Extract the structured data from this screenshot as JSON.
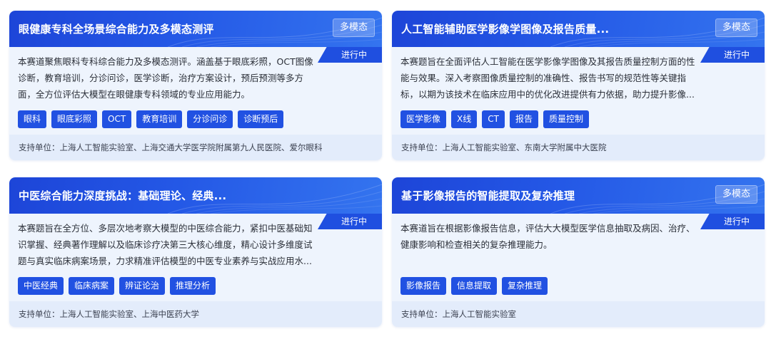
{
  "cards": [
    {
      "title": "眼健康专科全场景综合能力及多模态测评",
      "modality": "多模态",
      "status": "进行中",
      "desc": [
        "本赛道聚焦眼科专科综合能力及多模态测评。涵盖基于眼底彩照，OCT图像",
        "诊断，教育培训，分诊问诊，医学诊断，治疗方案设计，预后预测等多方",
        "面，全方位评估大模型在眼健康专科领域的专业应用能力。"
      ],
      "tags": [
        "眼科",
        "眼底彩照",
        "OCT",
        "教育培训",
        "分诊问诊",
        "诊断预后"
      ],
      "support": "支持单位：上海人工智能实验室、上海交通大学医学院附属第九人民医院、爱尔眼科"
    },
    {
      "title": "人工智能辅助医学影像学图像及报告质量...",
      "modality": "多模态",
      "status": "进行中",
      "desc": [
        "本赛题旨在全面评估人工智能在医学影像学图像及其报告质量控制方面的性",
        "能与效果。深入考察图像质量控制的准确性、报告书写的规范性等关键指",
        "标，以期为该技术在临床应用中的优化改进提供有力依据，助力提升影像..."
      ],
      "tags": [
        "医学影像",
        "X线",
        "CT",
        "报告",
        "质量控制"
      ],
      "support": "支持单位：上海人工智能实验室、东南大学附属中大医院"
    },
    {
      "title": "中医综合能力深度挑战：基础理论、经典...",
      "status": "进行中",
      "desc": [
        "本赛题旨在全方位、多层次地考察大模型的中医综合能力，紧扣中医基础知",
        "识掌握、经典著作理解以及临床诊疗决第三大核心维度，精心设计多维度试",
        "题与真实临床病案场景，力求精准评估模型的中医专业素养与实战应用水..."
      ],
      "tags": [
        "中医经典",
        "临床病案",
        "辨证论治",
        "推理分析"
      ],
      "support": "支持单位：上海人工智能实验室、上海中医药大学"
    },
    {
      "title": "基于影像报告的智能提取及复杂推理",
      "modality": "多模态",
      "status": "进行中",
      "desc": [
        "本赛道旨在根据影像报告信息，评估大大模型医学信息抽取及病因、治疗、",
        "健康影响和检查相关的复杂推理能力。"
      ],
      "tags": [
        "影像报告",
        "信息提取",
        "复杂推理"
      ],
      "support": "支持单位：上海人工智能实验室"
    }
  ]
}
